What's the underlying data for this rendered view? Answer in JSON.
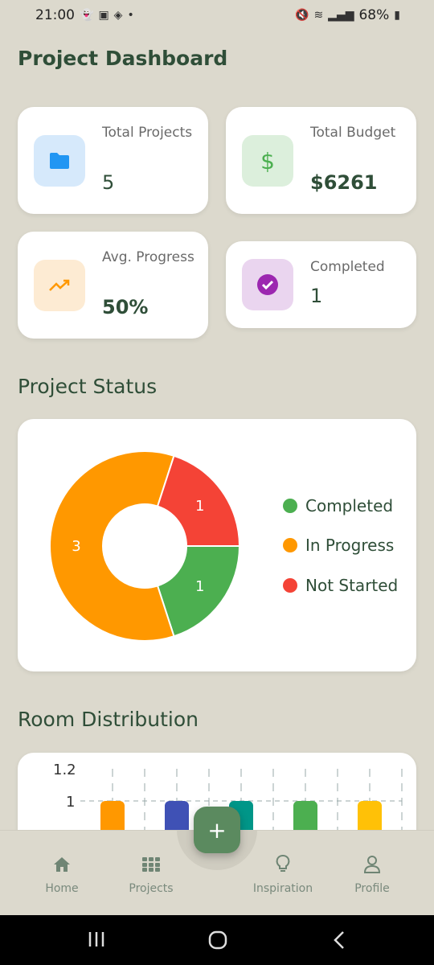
{
  "status_bar": {
    "time": "21:00",
    "battery": "68%"
  },
  "page_title": "Project Dashboard",
  "stats": [
    {
      "label": "Total Projects",
      "value": "5",
      "icon": "folder-icon",
      "color": "#2196f3",
      "bg": "#d6e9fb"
    },
    {
      "label": "Total Budget",
      "value": "$6261",
      "icon": "dollar-icon",
      "color": "#4caf50",
      "bg": "#dcefdc"
    },
    {
      "label": "Avg. Progress",
      "value": "50%",
      "icon": "trending-up-icon",
      "color": "#ff9800",
      "bg": "#fdebd3"
    },
    {
      "label": "Completed",
      "value": "1",
      "icon": "check-circle-icon",
      "color": "#9c27b0",
      "bg": "#ead5ef"
    }
  ],
  "project_status": {
    "title": "Project Status",
    "chart_data": {
      "type": "pie",
      "categories": [
        "Completed",
        "In Progress",
        "Not Started"
      ],
      "values": [
        1,
        3,
        1
      ],
      "colors": [
        "#4caf50",
        "#ff9800",
        "#f44336"
      ],
      "legend_position": "right"
    }
  },
  "room_distribution": {
    "title": "Room Distribution",
    "chart_data": {
      "type": "bar",
      "ytick_labels": [
        "1.2",
        "1"
      ],
      "values": [
        1,
        1,
        1,
        1,
        1
      ],
      "colors": [
        "#ff9800",
        "#3f51b5",
        "#009688",
        "#4caf50",
        "#ffc107"
      ]
    }
  },
  "nav": {
    "items": [
      {
        "label": "Home",
        "icon": "home-icon"
      },
      {
        "label": "Projects",
        "icon": "grid-icon"
      },
      {
        "label": "Inspiration",
        "icon": "lightbulb-icon"
      },
      {
        "label": "Profile",
        "icon": "person-icon"
      }
    ],
    "fab": "+"
  }
}
